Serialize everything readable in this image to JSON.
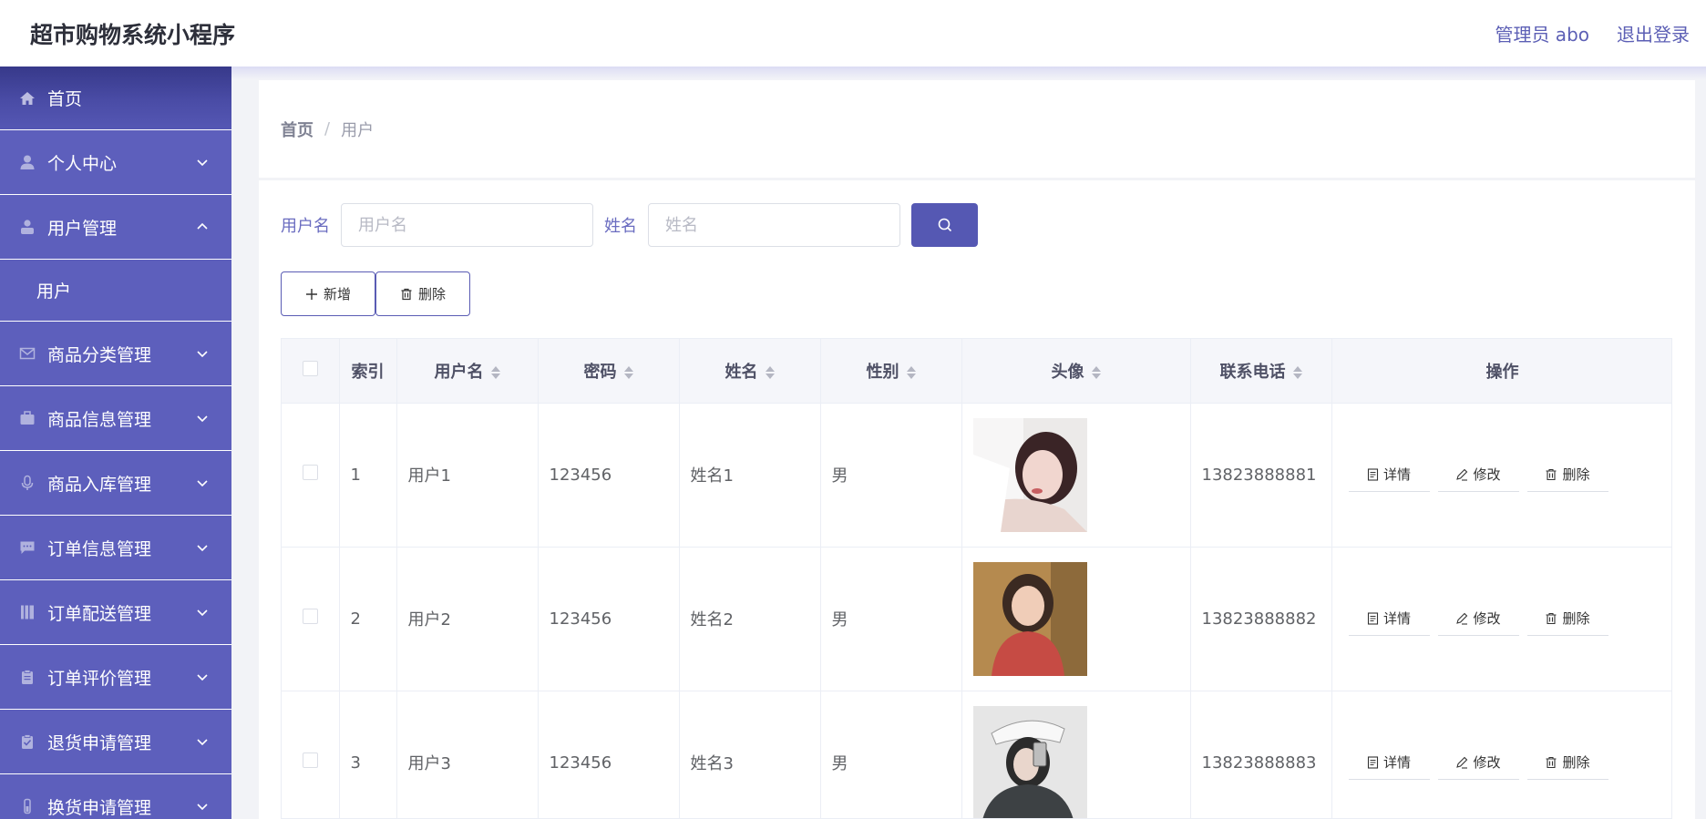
{
  "header": {
    "title": "超市购物系统小程序",
    "admin": "管理员 abo",
    "logout": "退出登录"
  },
  "sidebar": {
    "items": [
      {
        "label": "首页",
        "icon": "home-icon"
      },
      {
        "label": "个人中心",
        "icon": "user-icon"
      },
      {
        "label": "用户管理",
        "icon": "user-manage-icon",
        "expanded": true,
        "children": [
          "用户"
        ]
      },
      {
        "label": "商品分类管理",
        "icon": "mail-icon"
      },
      {
        "label": "商品信息管理",
        "icon": "briefcase-icon"
      },
      {
        "label": "商品入库管理",
        "icon": "microphone-icon"
      },
      {
        "label": "订单信息管理",
        "icon": "chat-icon"
      },
      {
        "label": "订单配送管理",
        "icon": "notebook-icon"
      },
      {
        "label": "订单评价管理",
        "icon": "clipboard-icon"
      },
      {
        "label": "退货申请管理",
        "icon": "clipboard-check-icon"
      },
      {
        "label": "换货申请管理",
        "icon": "tube-icon"
      }
    ]
  },
  "breadcrumb": {
    "home": "首页",
    "separator": "/",
    "current": "用户"
  },
  "search": {
    "username_label": "用户名",
    "username_placeholder": "用户名",
    "name_label": "姓名",
    "name_placeholder": "姓名"
  },
  "actions": {
    "add": "新增",
    "delete": "删除"
  },
  "table": {
    "headers": [
      "索引",
      "用户名",
      "密码",
      "姓名",
      "性别",
      "头像",
      "联系电话",
      "操作"
    ],
    "rows": [
      {
        "index": "1",
        "username": "用户1",
        "password": "123456",
        "name": "姓名1",
        "gender": "男",
        "phone": "13823888881"
      },
      {
        "index": "2",
        "username": "用户2",
        "password": "123456",
        "name": "姓名2",
        "gender": "男",
        "phone": "13823888882"
      },
      {
        "index": "3",
        "username": "用户3",
        "password": "123456",
        "name": "姓名3",
        "gender": "男",
        "phone": "13823888883"
      }
    ],
    "row_ops": {
      "detail": "详情",
      "edit": "修改",
      "delete": "删除"
    }
  },
  "colors": {
    "sidebar": "#5d5fbc",
    "accent": "#5558b3",
    "header_text": "#5c5fb5"
  }
}
